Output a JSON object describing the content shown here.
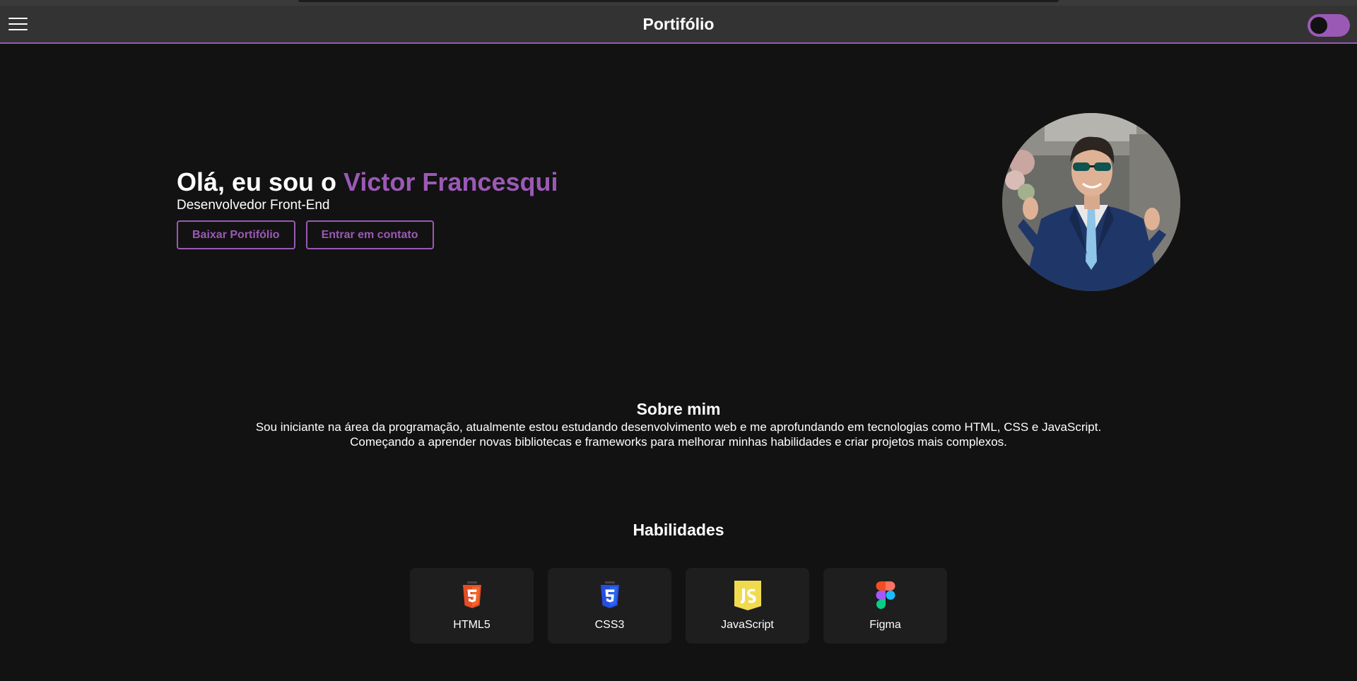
{
  "navbar": {
    "title": "Portifólio",
    "menu_icon": "hamburger-menu-icon",
    "theme_toggle": {
      "state": "dark",
      "accent": "#9b59b6"
    }
  },
  "hero": {
    "greeting": "Olá, eu sou o ",
    "name": "Victor Francesqui",
    "subtitle": "Desenvolvedor Front-End",
    "buttons": {
      "download": "Baixar Portifólio",
      "contact": "Entrar em contato"
    }
  },
  "about": {
    "title": "Sobre mim",
    "line1": "Sou iniciante na área da programação, atualmente estou estudando desenvolvimento web e me aprofundando em tecnologias como HTML, CSS e JavaScript.",
    "line2": "Começando a aprender novas bibliotecas e frameworks para melhorar minhas habilidades e criar projetos mais complexos."
  },
  "skills": {
    "title": "Habilidades",
    "items": [
      {
        "label": "HTML5",
        "icon": "html5-icon",
        "color": "#e44d26"
      },
      {
        "label": "CSS3",
        "icon": "css3-icon",
        "color": "#264de4"
      },
      {
        "label": "JavaScript",
        "icon": "javascript-icon",
        "color": "#f0db4f"
      },
      {
        "label": "Figma",
        "icon": "figma-icon",
        "color": "#a259ff"
      }
    ]
  },
  "colors": {
    "background": "#121212",
    "accent": "#9b59b6",
    "navbar": "#333333",
    "card": "#1e1e1e"
  }
}
